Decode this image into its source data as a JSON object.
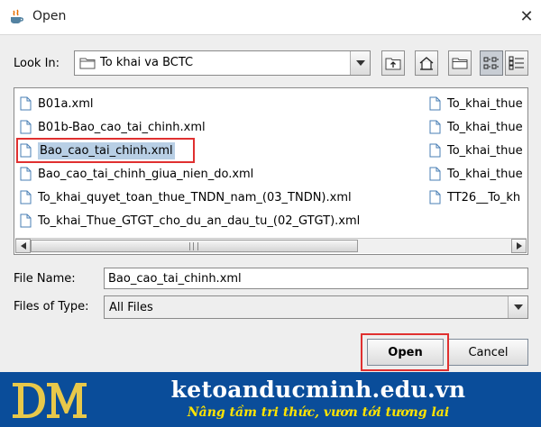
{
  "window": {
    "title": "Open",
    "close_glyph": "✕"
  },
  "look_in": {
    "label": "Look In:",
    "value": "To khai va BCTC"
  },
  "toolbar": {
    "icons": [
      "up-one-level-icon",
      "home-icon",
      "new-folder-icon",
      "list-view-icon",
      "details-view-icon"
    ],
    "pressed": "list-view-icon"
  },
  "files": {
    "column1": [
      "B01a.xml",
      "B01b-Bao_cao_tai_chinh.xml",
      "Bao_cao_tai_chinh.xml",
      "Bao_cao_tai_chinh_giua_nien_do.xml",
      "To_khai_quyet_toan_thue_TNDN_nam_(03_TNDN).xml",
      "To_khai_Thue_GTGT_cho_du_an_dau_tu_(02_GTGT).xml"
    ],
    "column2": [
      "To_khai_thue",
      "To_khai_thue",
      "To_khai_thue",
      "To_khai_thue",
      "TT26__To_kh"
    ],
    "selected": "Bao_cao_tai_chinh.xml"
  },
  "file_name": {
    "label": "File Name:",
    "value": "Bao_cao_tai_chinh.xml"
  },
  "files_of_type": {
    "label": "Files of Type:",
    "value": "All Files"
  },
  "buttons": {
    "open": "Open",
    "cancel": "Cancel"
  },
  "banner": {
    "logo_letters": "DM",
    "site": "ketoanducminh.edu.vn",
    "slogan": "Nâng tầm tri thức, vươn tới tương lai",
    "bg_color": "#0a4d9a",
    "slogan_color": "#ffe400",
    "logo_color": "#e8c84a"
  },
  "colors": {
    "highlight_outline": "#e03030",
    "selection": "#b8cfe5"
  }
}
